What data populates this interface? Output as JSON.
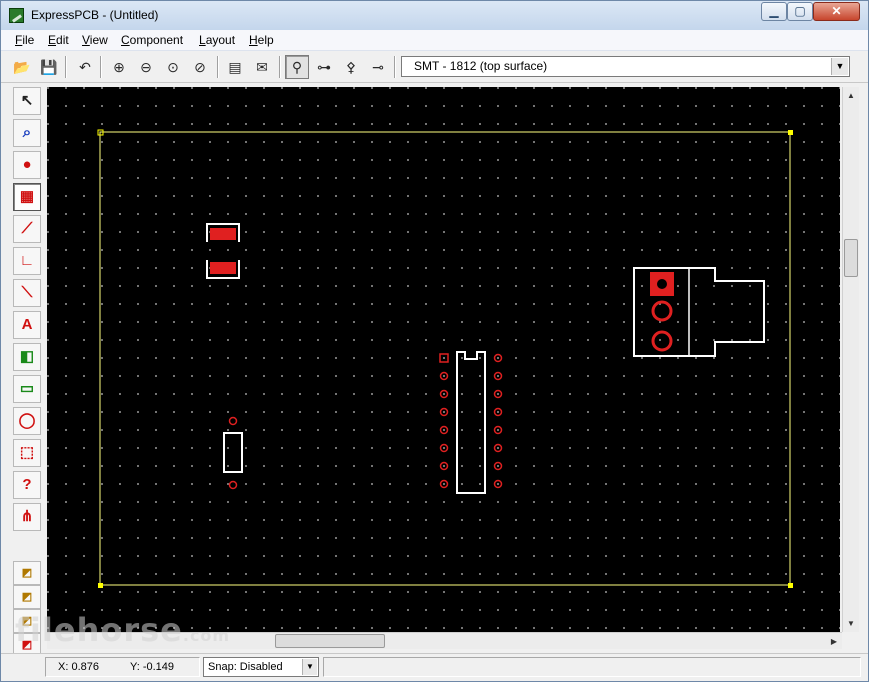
{
  "window": {
    "title": "ExpressPCB - (Untitled)"
  },
  "menu": [
    {
      "pre": "",
      "ul": "F",
      "post": "ile"
    },
    {
      "pre": "",
      "ul": "E",
      "post": "dit"
    },
    {
      "pre": "",
      "ul": "V",
      "post": "iew"
    },
    {
      "pre": "",
      "ul": "C",
      "post": "omponent"
    },
    {
      "pre": "",
      "ul": "L",
      "post": "ayout"
    },
    {
      "pre": "",
      "ul": "H",
      "post": "elp"
    }
  ],
  "toolbar": {
    "layer_select_value": "SMT - 1812  (top surface)",
    "buttons": [
      {
        "name": "open-icon",
        "glyph": "📂"
      },
      {
        "name": "save-icon",
        "glyph": "💾"
      },
      {
        "name": "undo-icon",
        "glyph": "↶"
      },
      {
        "name": "zoom-in-icon",
        "glyph": "⊕"
      },
      {
        "name": "zoom-out-icon",
        "glyph": "⊖"
      },
      {
        "name": "zoom-fit-icon",
        "glyph": "⊙"
      },
      {
        "name": "zoom-previous-icon",
        "glyph": "⊘"
      },
      {
        "name": "properties-icon",
        "glyph": "▤"
      },
      {
        "name": "order-pcb-icon",
        "glyph": "✉"
      },
      {
        "name": "component-mode-icon",
        "glyph": "⚲"
      },
      {
        "name": "trace-mode-icon",
        "glyph": "⊶"
      },
      {
        "name": "pin-mode-icon",
        "glyph": "⚴"
      },
      {
        "name": "pad-mode-icon",
        "glyph": "⊸"
      }
    ]
  },
  "left_tools": [
    {
      "name": "select-tool-icon",
      "glyph": "↖",
      "color": "#222222"
    },
    {
      "name": "zoom-select-tool-icon",
      "glyph": "⌕",
      "color": "#1a3fbf"
    },
    {
      "name": "place-pad-tool-icon",
      "glyph": "●",
      "color": "#d01010"
    },
    {
      "name": "place-component-tool-icon",
      "glyph": "▦",
      "color": "#d01010"
    },
    {
      "name": "trace-tool-icon",
      "glyph": "⟋",
      "color": "#d01010"
    },
    {
      "name": "corner-trace-tool-icon",
      "glyph": "∟",
      "color": "#d01010"
    },
    {
      "name": "diagonal-trace-tool-icon",
      "glyph": "⟍",
      "color": "#d01010"
    },
    {
      "name": "text-tool-icon",
      "glyph": "A",
      "color": "#d01010"
    },
    {
      "name": "fill-plane-tool-icon",
      "glyph": "◧",
      "color": "#1a8a1a"
    },
    {
      "name": "ground-plane-tool-icon",
      "glyph": "▭",
      "color": "#1a8a1a"
    },
    {
      "name": "circle-tool-icon",
      "glyph": "◯",
      "color": "#d01010"
    },
    {
      "name": "rectangle-tool-icon",
      "glyph": "⬚",
      "color": "#d01010"
    },
    {
      "name": "pad-query-tool-icon",
      "glyph": "?",
      "color": "#d01010"
    },
    {
      "name": "netlist-tool-icon",
      "glyph": "⋔",
      "color": "#d01010"
    }
  ],
  "status": {
    "x": "X: 0.876",
    "y": "Y: -0.149",
    "snap": "Snap:  Disabled"
  },
  "watermark": {
    "main": "filehorse",
    "suffix": ".com"
  },
  "colors": {
    "board_outline": "#ffff80",
    "silkscreen": "#ffffff",
    "copper": "#e02020",
    "canvas_bg": "#000000"
  }
}
